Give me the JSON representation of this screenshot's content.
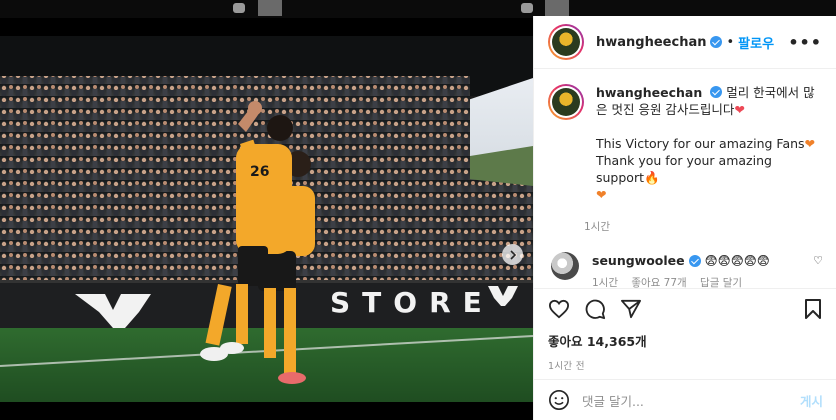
{
  "header": {
    "username": "hwangheechan",
    "dot": "•",
    "follow_label": "팔로우",
    "more_label": "•••"
  },
  "caption": {
    "username": "hwangheechan",
    "line1": "멀리 한국에서 많은 멋진 응원 감사드립니다",
    "line2": "This Victory for our amazing Fans",
    "line3": "Thank you for your amazing support",
    "time": "1시간"
  },
  "comment": {
    "username": "seungwoolee",
    "text": "😨😨😨😨😨",
    "time": "1시간",
    "likes": "좋아요 77개",
    "reply": "답글 달기"
  },
  "post": {
    "likes_label": "좋아요 14,365개",
    "time": "1시간 전"
  },
  "add_comment": {
    "placeholder": "댓글 달기...",
    "post_label": "게시"
  },
  "photo": {
    "banner_text": "STORE",
    "carousel_dots": 3
  },
  "colors": {
    "accent": "#0095f6",
    "heart": "#ed4956",
    "kit": "#f3a82a"
  }
}
